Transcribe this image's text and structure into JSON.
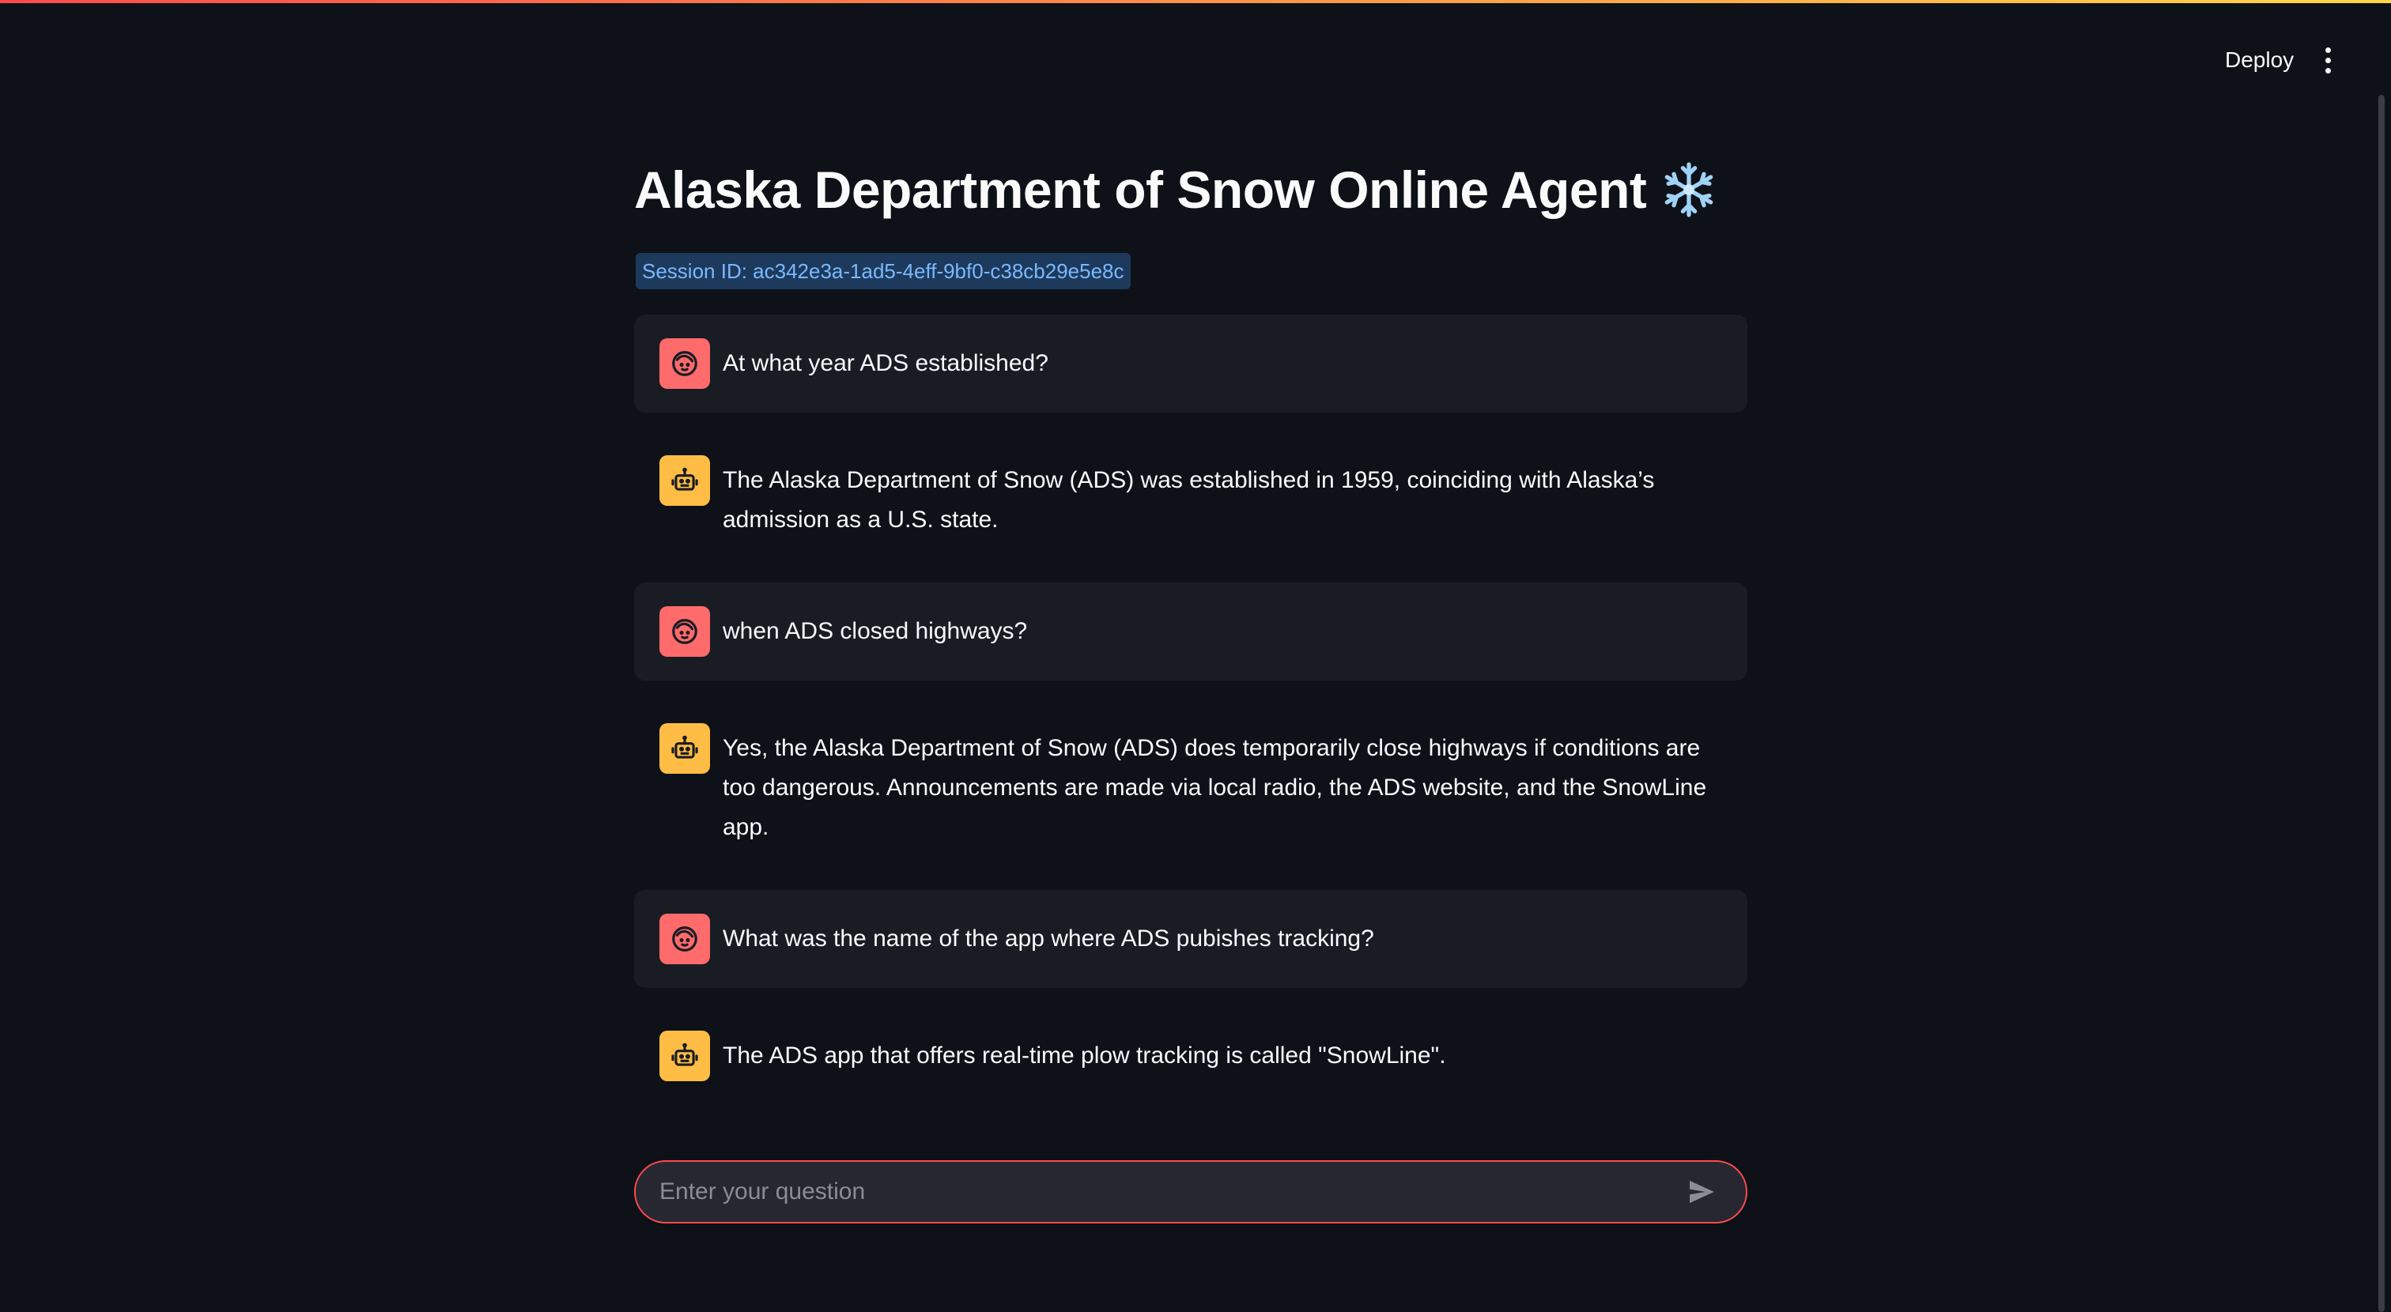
{
  "header": {
    "deploy_label": "Deploy",
    "menu_icon": "more-vertical-icon"
  },
  "main": {
    "title": "Alaska Department of Snow Online Agent",
    "title_icon": "snowflake-icon",
    "session_label": "Session ID: ac342e3a-1ad5-4eff-9bf0-c38cb29e5e8c"
  },
  "messages": [
    {
      "role": "user",
      "avatar_icon": "user-face-icon",
      "text": "At what year ADS established?"
    },
    {
      "role": "assistant",
      "avatar_icon": "robot-icon",
      "text": "The Alaska Department of Snow (ADS) was established in 1959, coinciding with Alaska’s admission as a U.S. state."
    },
    {
      "role": "user",
      "avatar_icon": "user-face-icon",
      "text": "when ADS closed highways?"
    },
    {
      "role": "assistant",
      "avatar_icon": "robot-icon",
      "text": "Yes, the Alaska Department of Snow (ADS) does temporarily close highways if conditions are too dangerous. Announcements are made via local radio, the ADS website, and the SnowLine app."
    },
    {
      "role": "user",
      "avatar_icon": "user-face-icon",
      "text": "What was the name of the app where ADS pubishes tracking?"
    },
    {
      "role": "assistant",
      "avatar_icon": "robot-icon",
      "text": "The ADS app that offers real-time plow tracking is called \"SnowLine\"."
    }
  ],
  "chat_input": {
    "placeholder": "Enter your question",
    "value": "",
    "send_icon": "send-icon"
  },
  "colors": {
    "background": "#0e1117",
    "accent": "#ff4b4b",
    "user_avatar": "#ff6b6b",
    "assistant_avatar": "#ffbd45",
    "session_badge_bg": "#1d3a5c",
    "session_badge_text": "#7ab8ff"
  }
}
